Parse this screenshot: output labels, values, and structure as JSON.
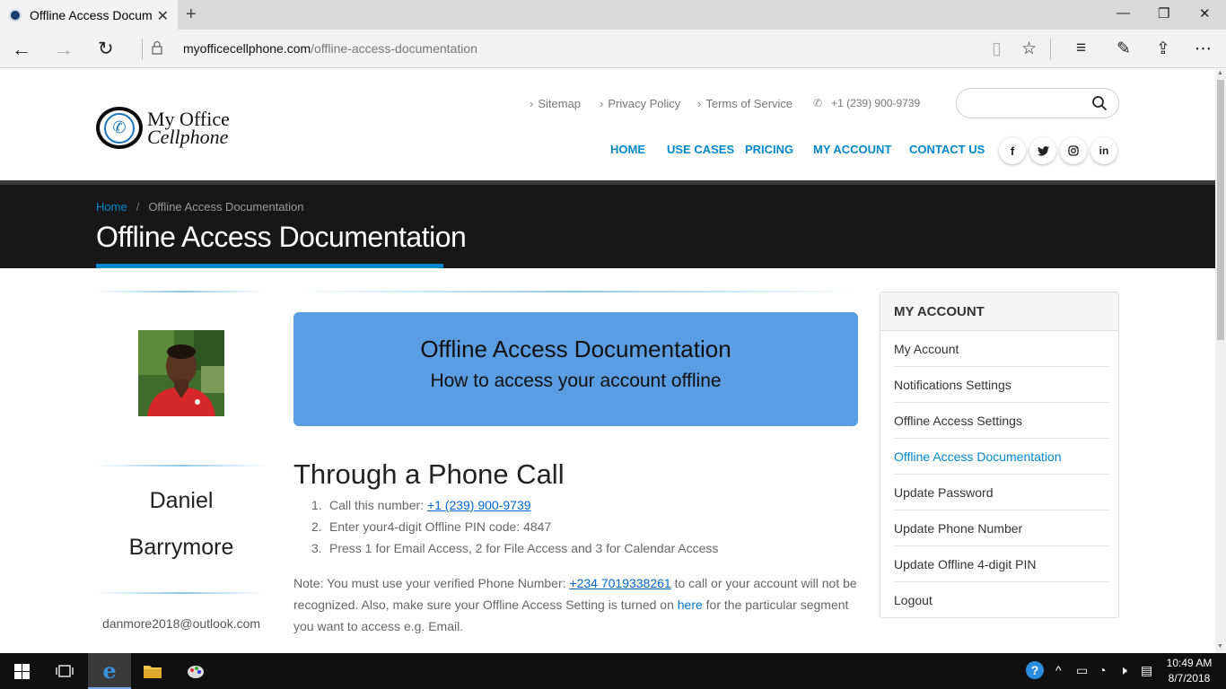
{
  "browser": {
    "tab_title": "Offline Access Documer",
    "url_domain": "myofficecellphone.com",
    "url_path": "/offline-access-documentation"
  },
  "site": {
    "logo_line1": "My Office",
    "logo_line2": "Cellphone",
    "toplinks": [
      "Sitemap",
      "Privacy Policy",
      "Terms of Service"
    ],
    "phone": "+1 (239) 900-9739",
    "nav": [
      "HOME",
      "USE CASES",
      "PRICING",
      "MY ACCOUNT",
      "CONTACT US"
    ],
    "social_icons": [
      "facebook-icon",
      "twitter-icon",
      "instagram-icon",
      "linkedin-icon"
    ]
  },
  "header": {
    "breadcrumb_home": "Home",
    "breadcrumb_current": "Offline Access Documentation",
    "title": "Offline Access Documentation"
  },
  "profile": {
    "first_name": "Daniel",
    "last_name": "Barrymore",
    "email": "danmore2018@outlook.com"
  },
  "main": {
    "hero_title": "Offline Access Documentation",
    "hero_subtitle": "How to access your account offline",
    "section_title": "Through a Phone Call",
    "steps": [
      {
        "num": "1.",
        "text": "Call this number: ",
        "link": "+1 (239) 900-9739"
      },
      {
        "num": "2.",
        "text": "Enter your4-digit Offline PIN code: 4847"
      },
      {
        "num": "3.",
        "text": "Press 1 for Email Access, 2 for File Access and 3 for Calendar Access"
      }
    ],
    "note_prefix": "Note: You must use your verified Phone Number: ",
    "note_phone": "+234 7019338261",
    "note_middle": " to call or your account will not be recognized. Also, make sure your Offline Access Setting is turned on ",
    "note_here": "here",
    "note_suffix": " for the particular segment you want to access e.g. Email."
  },
  "sidebar": {
    "title": "MY ACCOUNT",
    "items": [
      "My Account",
      "Notifications Settings",
      "Offline Access Settings",
      "Offline Access Documentation",
      "Update Password",
      "Update Phone Number",
      "Update Offline 4-digit PIN",
      "Logout"
    ],
    "active_index": 3
  },
  "taskbar": {
    "time": "10:49 AM",
    "date": "8/7/2018"
  },
  "colors": {
    "accent": "#0088cc",
    "hero": "#5b9de2",
    "header_bg": "#171717"
  }
}
